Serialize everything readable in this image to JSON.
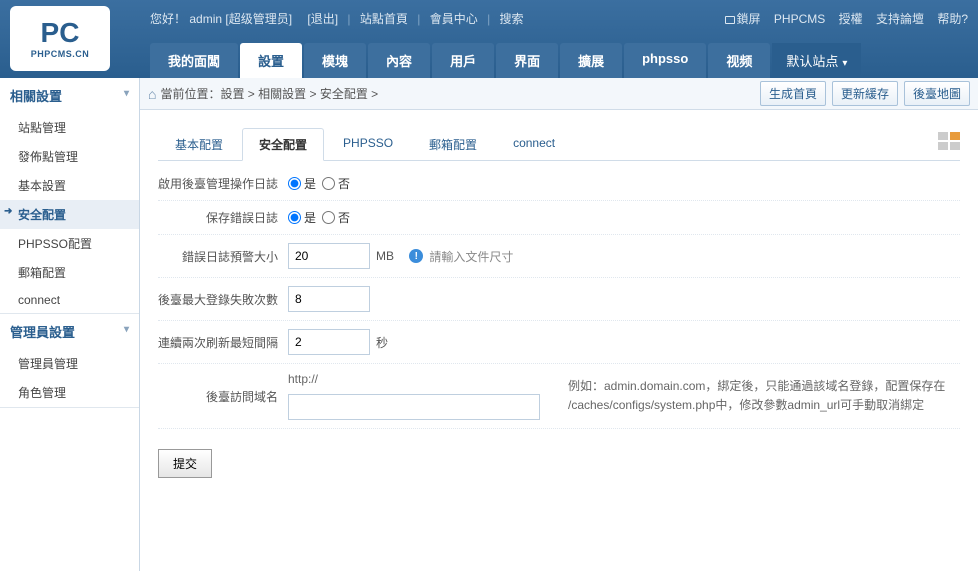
{
  "header": {
    "logo_main": "PC",
    "logo_sub": "PHPCMS.CN",
    "greeting": "您好！",
    "username": "admin",
    "role": "[超级管理员]",
    "logout": "[退出]",
    "home_link": "站點首頁",
    "member_center": "會員中心",
    "search": "搜索",
    "lock": "鎖屏",
    "phpcms": "PHPCMS",
    "license": "授權",
    "forum": "支持論壇",
    "help": "帮助?"
  },
  "main_nav": {
    "items": [
      "我的面闆",
      "設置",
      "模塊",
      "內容",
      "用戶",
      "界面",
      "擴展",
      "phpsso",
      "视频"
    ],
    "active_index": 1,
    "site_selector": "默认站点",
    "chev": "▾"
  },
  "sidebar": {
    "groups": [
      {
        "title": "相關設置",
        "open": true,
        "items": [
          {
            "label": "站點管理"
          },
          {
            "label": "發佈點管理"
          },
          {
            "label": "基本設置"
          },
          {
            "label": "安全配置",
            "active": true
          },
          {
            "label": "PHPSSO配置"
          },
          {
            "label": "郵箱配置"
          },
          {
            "label": "connect"
          }
        ]
      },
      {
        "title": "管理員設置",
        "open": true,
        "items": [
          {
            "label": "管理員管理"
          },
          {
            "label": "角色管理"
          }
        ]
      }
    ]
  },
  "breadcrumb": {
    "prefix": "當前位置：",
    "parts": [
      "設置",
      "相關設置",
      "安全配置"
    ],
    "sep": " > ",
    "actions": [
      "生成首頁",
      "更新緩存",
      "後臺地圖"
    ]
  },
  "content_tabs": {
    "items": [
      "基本配置",
      "安全配置",
      "PHPSSO",
      "郵箱配置",
      "connect"
    ],
    "active_index": 1
  },
  "form": {
    "enable_log": {
      "label": "啟用後臺管理操作日誌",
      "yes": "是",
      "no": "否",
      "value": "yes"
    },
    "save_err": {
      "label": "保存錯誤日誌",
      "yes": "是",
      "no": "否",
      "value": "yes"
    },
    "err_size": {
      "label": "錯誤日誌預警大小",
      "value": "20",
      "unit": "MB",
      "hint": "請輸入文件尺寸"
    },
    "max_fail": {
      "label": "後臺最大登錄失敗次數",
      "value": "8"
    },
    "refresh": {
      "label": "連續兩次刷新最短間隔",
      "value": "2",
      "unit": "秒"
    },
    "domain": {
      "label": "後臺訪問域名",
      "prefix": "http://",
      "value": "",
      "help": "例如：admin.domain.com，綁定後，只能通過該域名登錄，配置保存在 /caches/configs/system.php中，修改參數admin_url可手動取消綁定"
    },
    "submit": "提交"
  }
}
